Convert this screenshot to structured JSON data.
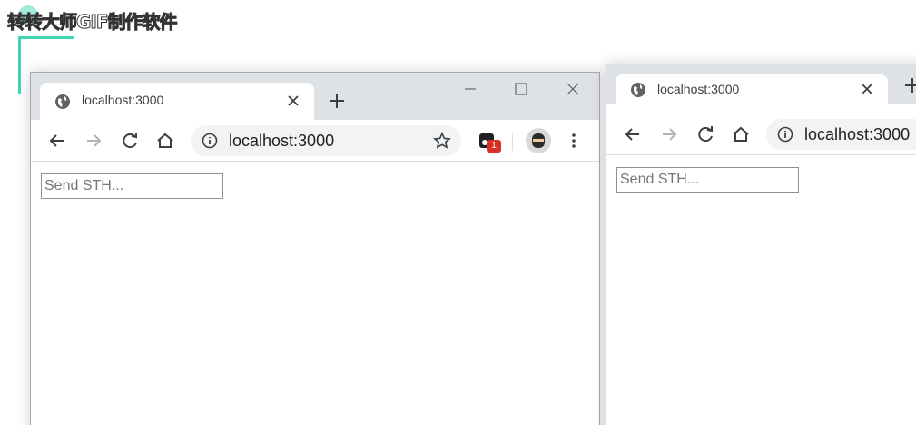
{
  "watermark": {
    "text": "转转大师GIF制作软件"
  },
  "windows": [
    {
      "tab_title": "localhost:3000",
      "url": "localhost:3000",
      "extension_badge": "1",
      "input_placeholder": "Send STH..."
    },
    {
      "tab_title": "localhost:3000",
      "url": "localhost:3000",
      "input_placeholder": "Send STH..."
    }
  ],
  "icons": {
    "tab": "globe-icon",
    "close": "close-icon",
    "new_tab": "plus-icon",
    "back": "back-arrow-icon",
    "forward": "forward-arrow-icon",
    "reload": "reload-icon",
    "home": "home-icon",
    "site_info": "info-icon",
    "bookmark": "star-icon",
    "menu": "kebab-menu-icon"
  },
  "colors": {
    "tabstrip": "#dee1e6",
    "omnibox": "#f1f3f4",
    "badge": "#d93025",
    "watermark_accent": "#3fd6b4"
  }
}
